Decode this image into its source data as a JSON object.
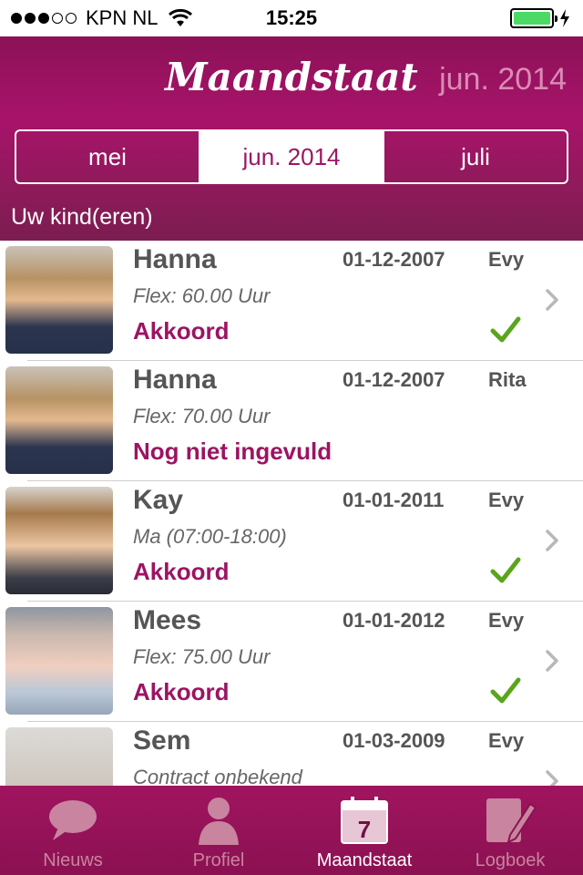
{
  "status_bar": {
    "carrier": "KPN NL",
    "time": "15:25",
    "battery_percent": 100
  },
  "header": {
    "title": "Maandstaat",
    "current_month": "jun. 2014"
  },
  "month_selector": {
    "prev": "mei",
    "current": "jun. 2014",
    "next": "juli"
  },
  "section_label": "Uw kind(eren)",
  "children": [
    {
      "name": "Hanna",
      "dob": "01-12-2007",
      "staff": "Evy",
      "contract": "Flex: 60.00 Uur",
      "status": "Akkoord",
      "approved": true,
      "has_chevron": true
    },
    {
      "name": "Hanna",
      "dob": "01-12-2007",
      "staff": "Rita",
      "contract": "Flex: 70.00 Uur",
      "status": "Nog niet ingevuld",
      "approved": false,
      "has_chevron": false
    },
    {
      "name": "Kay",
      "dob": "01-01-2011",
      "staff": "Evy",
      "contract": "Ma (07:00-18:00)",
      "status": "Akkoord",
      "approved": true,
      "has_chevron": true
    },
    {
      "name": "Mees",
      "dob": "01-01-2012",
      "staff": "Evy",
      "contract": "Flex: 75.00 Uur",
      "status": "Akkoord",
      "approved": true,
      "has_chevron": true
    },
    {
      "name": "Sem",
      "dob": "01-03-2009",
      "staff": "Evy",
      "contract": "Contract onbekend",
      "status": "",
      "approved": false,
      "has_chevron": true
    }
  ],
  "tabs": [
    {
      "label": "Nieuws",
      "icon": "speech-bubble-icon",
      "active": false
    },
    {
      "label": "Profiel",
      "icon": "person-icon",
      "active": false
    },
    {
      "label": "Maandstaat",
      "icon": "calendar-icon",
      "active": true,
      "calendar_day": "7"
    },
    {
      "label": "Logboek",
      "icon": "notebook-pencil-icon",
      "active": false
    }
  ],
  "colors": {
    "brand": "#9c1463",
    "approved": "#5aa51c"
  }
}
